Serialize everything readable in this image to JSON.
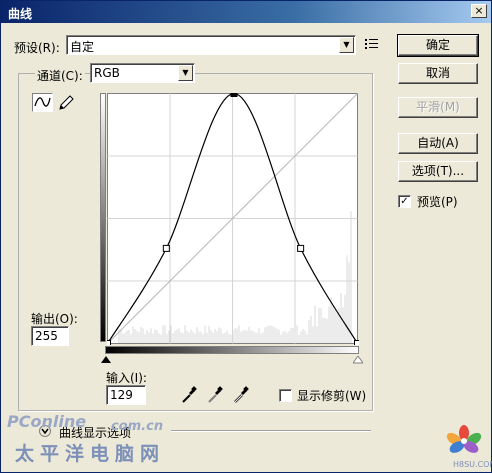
{
  "title": "曲线",
  "close_glyph": "×",
  "preset": {
    "label": "预设(R):",
    "value": "自定"
  },
  "channel": {
    "label": "通道(C):",
    "value": "RGB"
  },
  "buttons": {
    "ok": "确定",
    "cancel": "取消",
    "smooth": "平滑(M)",
    "auto": "自动(A)",
    "options": "选项(T)..."
  },
  "preview": {
    "label": "预览(P)",
    "checked": true
  },
  "output": {
    "label": "输出(O):",
    "value": "255"
  },
  "input": {
    "label": "输入(I):",
    "value": "129"
  },
  "show_clipping": {
    "label": "显示修剪(W)",
    "checked": false
  },
  "curve_display_options": "曲线显示选项",
  "icons": {
    "curve_tool": "curve-tool-icon",
    "pencil_tool": "pencil-tool-icon",
    "preset_menu": "preset-menu-icon",
    "black_eyedropper": "black-eyedropper-icon",
    "gray_eyedropper": "gray-eyedropper-icon",
    "white_eyedropper": "white-eyedropper-icon"
  },
  "watermark": {
    "line1": "PConline",
    "line1_suffix": "com.cn",
    "line2": "太平洋电脑网",
    "site": "H8SU.COM"
  },
  "curve": {
    "points": [
      [
        0,
        0
      ],
      [
        60,
        97
      ],
      [
        129,
        255
      ],
      [
        197,
        97
      ],
      [
        255,
        0
      ]
    ]
  },
  "colors": {
    "title_start": "#0a246a",
    "title_end": "#a6caf0",
    "dialog_bg": "#ece9d8"
  }
}
